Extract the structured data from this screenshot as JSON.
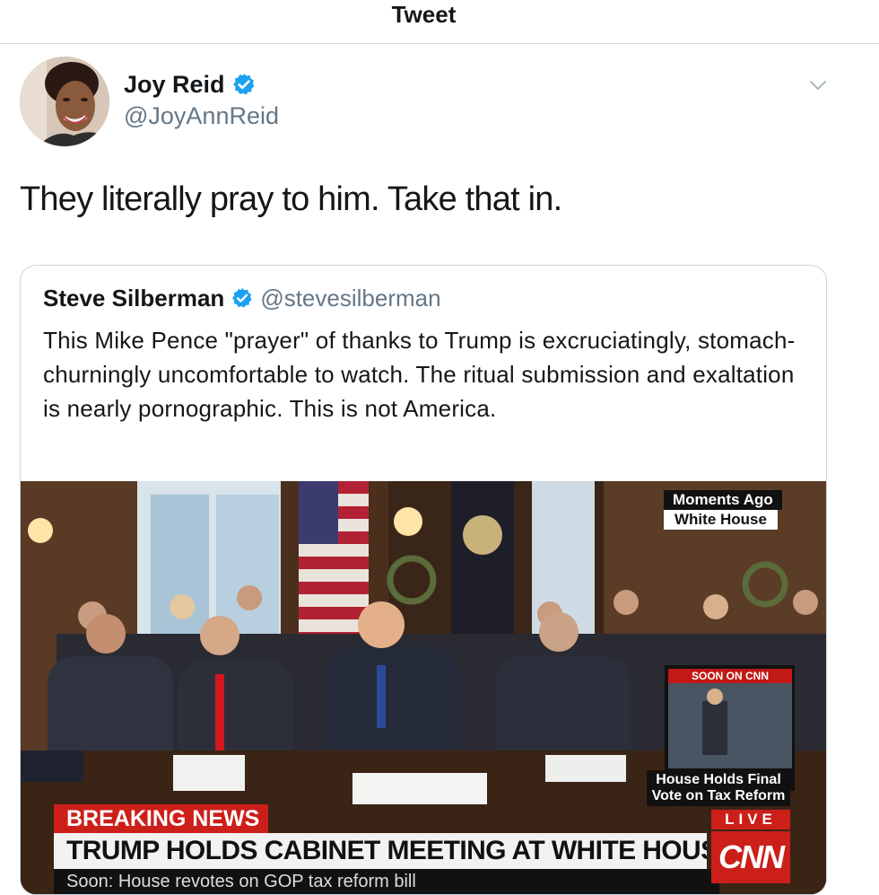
{
  "header": {
    "title": "Tweet"
  },
  "tweet": {
    "author_name": "Joy Reid",
    "author_handle": "@JoyAnnReid",
    "text": "They literally pray to him. Take that in."
  },
  "quoted_tweet": {
    "author_name": "Steve Silberman",
    "author_handle": "@stevesilberman",
    "text": "This Mike Pence \"prayer\" of thanks to Trump is excruciatingly, stomach-churningly uncomfortable to watch. The ritual submission and exaltation is nearly pornographic. This is not America."
  },
  "video": {
    "moments_label": "Moments Ago",
    "location_label": "White House",
    "soon_label": "SOON ON CNN",
    "promo_caption": "House Holds Final Vote on Tax Reform",
    "breaking_label": "BREAKING NEWS",
    "headline": "TRUMP HOLDS CABINET MEETING AT WHITE HOUSE",
    "ticker": "Soon: House revotes on GOP tax reform bill",
    "live_label": "LIVE",
    "network_logo": "CNN"
  },
  "icons": {
    "verified": "verified-badge-icon",
    "caret": "chevron-down-icon"
  },
  "colors": {
    "verified_blue": "#1da1f2",
    "secondary_text": "#657786",
    "cnn_red": "#cc1f1a",
    "border": "#ccd6dd"
  }
}
